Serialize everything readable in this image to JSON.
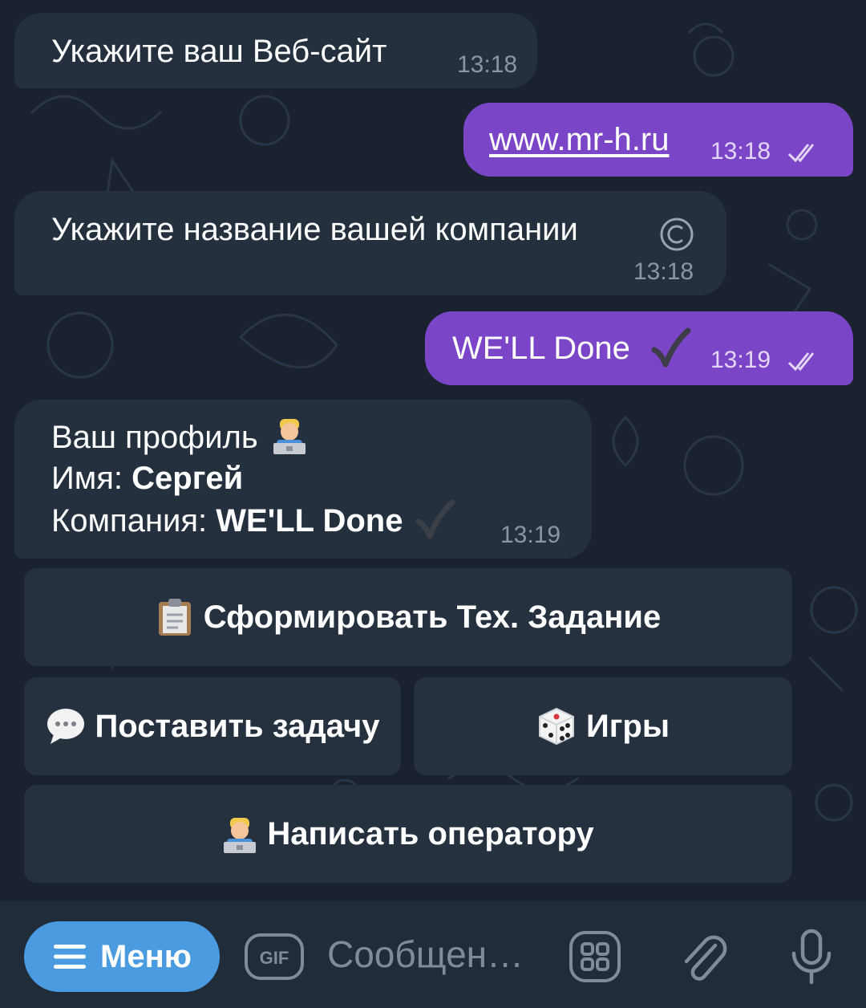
{
  "messages": [
    {
      "direction": "in",
      "text": "Укажите ваш Веб-сайт",
      "time": "13:18"
    },
    {
      "direction": "out",
      "text": "www.mr-h.ru",
      "time": "13:18",
      "status": "read-double-check-icon"
    },
    {
      "direction": "in",
      "text": "Укажите название вашей компании",
      "time": "13:18",
      "trailing_icon": "copyright-icon"
    },
    {
      "direction": "out",
      "text": "WE'LL Done",
      "time": "13:19",
      "trailing_icon": "check-mark-icon",
      "status": "read-double-check-icon"
    },
    {
      "direction": "in",
      "time": "13:19",
      "line1": "Ваш профиль",
      "line1_icon": "man-technologist-icon",
      "name_label": "Имя: ",
      "name_value": "Сергей",
      "company_label": "Компания: ",
      "company_value": "WE'LL Done",
      "company_icon": "check-mark-icon"
    }
  ],
  "keyboard": {
    "buttons": [
      {
        "label": "Сформировать Тех. Задание",
        "icon": "clipboard-icon"
      },
      {
        "label": "Поставить задачу",
        "icon": "speech-bubble-icon"
      },
      {
        "label": "Игры",
        "icon": "dice-icon"
      },
      {
        "label": "Написать оператору",
        "icon": "man-technologist-icon"
      }
    ]
  },
  "input_bar": {
    "menu_label": "Меню",
    "gif_label": "GIF",
    "placeholder": "Сообщен…",
    "icons": [
      "menu-icon",
      "gif-icon",
      "sticker-icon",
      "attach-icon",
      "microphone-icon"
    ]
  },
  "colors": {
    "background": "#1a2230",
    "incoming_bubble": "#25303f",
    "outgoing_bubble": "#7b45c7",
    "keyboard_button": "#263140",
    "menu_button": "#4a9be0"
  }
}
